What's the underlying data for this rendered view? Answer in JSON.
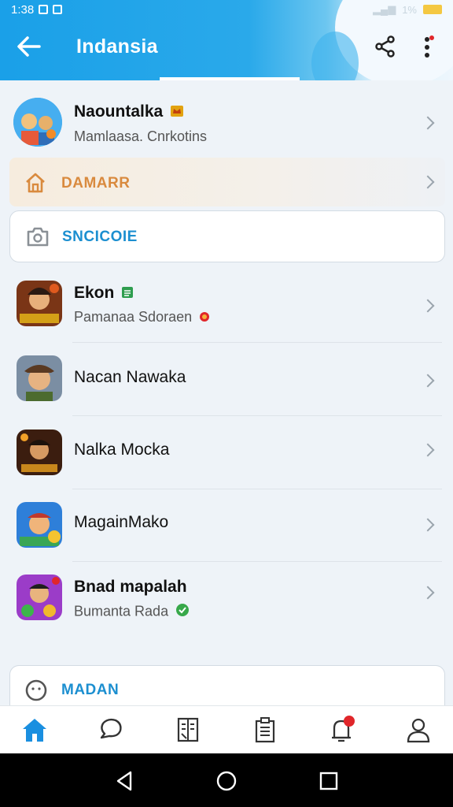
{
  "status_bar": {
    "time": "1:38",
    "battery_text": "1%"
  },
  "header": {
    "title": "Indansia"
  },
  "accent_color": "#1aa0e8",
  "top_profile": {
    "name": "Naountalka",
    "subtitle": "Mamlaasa. Cnrkotins"
  },
  "banner": {
    "label": "DAMARR"
  },
  "search_card": {
    "label": "SNCICOIE"
  },
  "list": [
    {
      "name": "Ekon",
      "subtitle": "Pamanaa Sdoraen",
      "bold": true
    },
    {
      "name": "Nacan Nawaka",
      "subtitle": "",
      "bold": false
    },
    {
      "name": "Nalka Mocka",
      "subtitle": "",
      "bold": false
    },
    {
      "name": "MagainMako",
      "subtitle": "",
      "bold": false
    },
    {
      "name": "Bnad mapalah",
      "subtitle": "Bumanta Rada",
      "bold": true
    }
  ],
  "bottom_card": {
    "label": "MADAN"
  },
  "tabs": [
    {
      "icon": "home-icon"
    },
    {
      "icon": "chat-icon"
    },
    {
      "icon": "book-icon"
    },
    {
      "icon": "clipboard-icon"
    },
    {
      "icon": "notifications-icon"
    },
    {
      "icon": "profile-icon"
    }
  ],
  "system_nav": [
    "back-icon",
    "home-circle-icon",
    "recents-icon"
  ]
}
